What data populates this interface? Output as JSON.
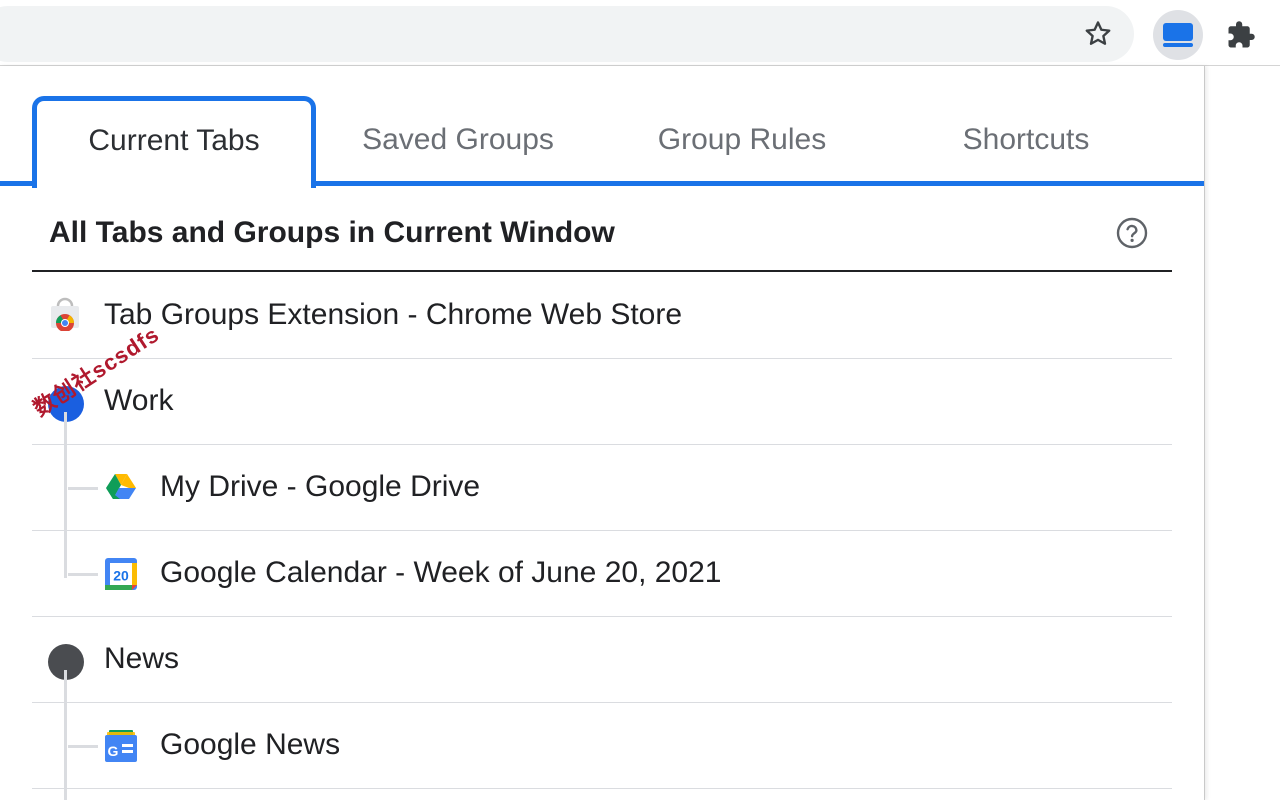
{
  "toolbar": {
    "icons": [
      "star-icon",
      "tab-groups-extension-icon",
      "puzzle-icon"
    ]
  },
  "popup": {
    "tabs": [
      {
        "label": "Current Tabs",
        "active": true
      },
      {
        "label": "Saved Groups",
        "active": false
      },
      {
        "label": "Group Rules",
        "active": false
      },
      {
        "label": "Shortcuts",
        "active": false
      }
    ],
    "section_title": "All Tabs and Groups in Current Window",
    "help_icon": "help-circle-icon",
    "rows": {
      "ungrouped_tab": {
        "title": "Tab Groups Extension - Chrome Web Store",
        "icon": "chrome-web-store-icon"
      },
      "group_work": {
        "name": "Work",
        "color": "#1a5fe0"
      },
      "work_tab_1": {
        "title": "My Drive - Google Drive",
        "icon": "google-drive-icon"
      },
      "work_tab_2": {
        "title": "Google Calendar - Week of June 20, 2021",
        "icon": "google-calendar-icon",
        "icon_text": "20"
      },
      "group_news": {
        "name": "News",
        "color": "#4a4c50"
      },
      "news_tab_1": {
        "title": "Google News",
        "icon": "google-news-icon",
        "icon_text": "G"
      }
    }
  },
  "watermark": {
    "text": "数创社scsdfs"
  }
}
